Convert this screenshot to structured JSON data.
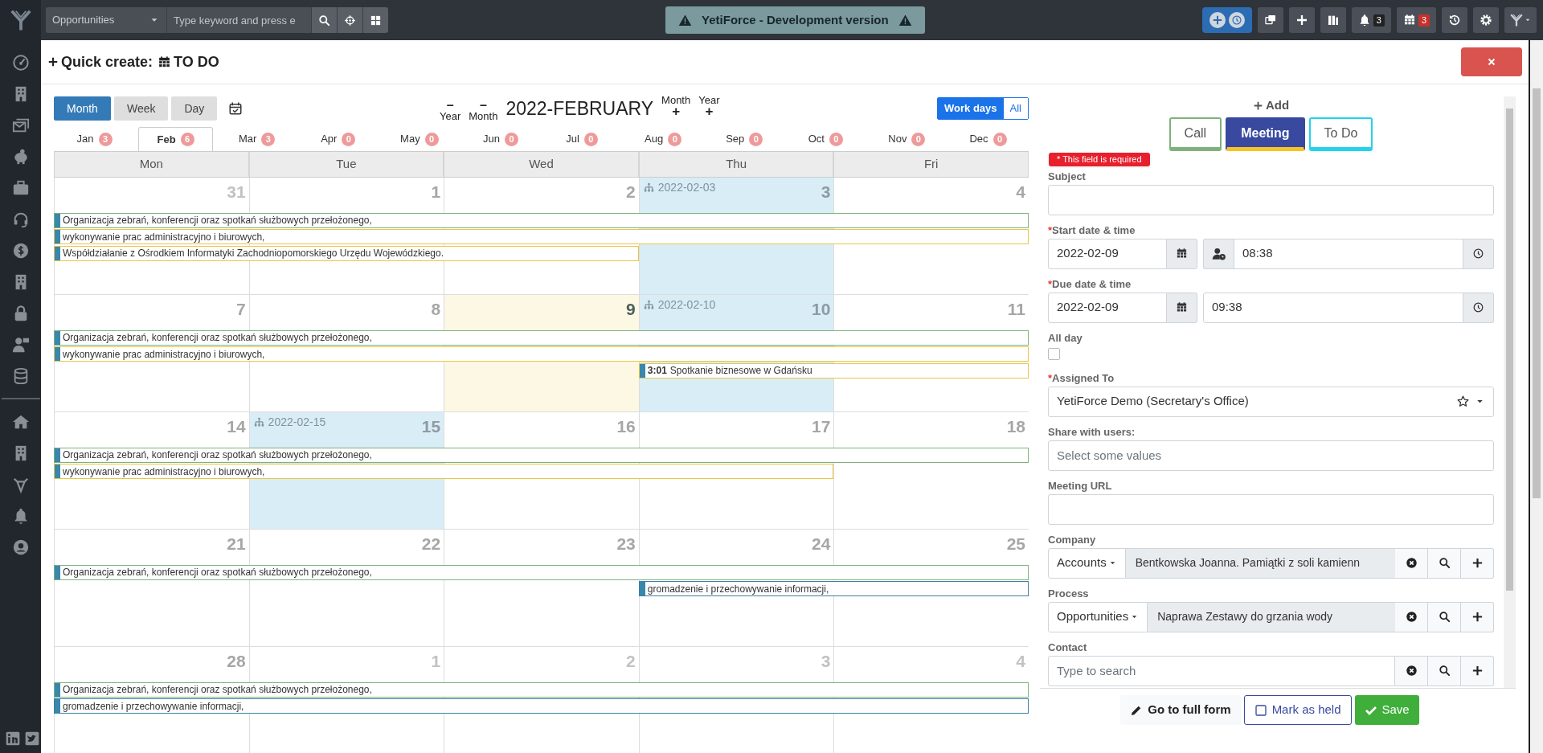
{
  "topbar": {
    "module": "Opportunities",
    "search_placeholder": "Type keyword and press e",
    "banner": "YetiForce - Development version",
    "bell_count": "3",
    "calendar_count": "3"
  },
  "modal": {
    "title_prefix": "Quick create:",
    "title": "TO DO"
  },
  "calendar": {
    "views": [
      {
        "label": "Month",
        "selected": true
      },
      {
        "label": "Week",
        "selected": false
      },
      {
        "label": "Day",
        "selected": false
      }
    ],
    "prev": [
      {
        "symbol": "–",
        "label": "Year"
      },
      {
        "symbol": "–",
        "label": "Month"
      }
    ],
    "title": "2022-FEBRUARY",
    "next": [
      {
        "label": "Month",
        "symbol": "+"
      },
      {
        "label": "Year",
        "symbol": "+"
      }
    ],
    "day_filter": [
      {
        "label": "Work days",
        "selected": true
      },
      {
        "label": "All",
        "selected": false
      }
    ],
    "months": [
      {
        "label": "Jan",
        "count": "3",
        "selected": false
      },
      {
        "label": "Feb",
        "count": "6",
        "selected": true
      },
      {
        "label": "Mar",
        "count": "3",
        "selected": false
      },
      {
        "label": "Apr",
        "count": "0",
        "selected": false
      },
      {
        "label": "May",
        "count": "0",
        "selected": false
      },
      {
        "label": "Jun",
        "count": "0",
        "selected": false
      },
      {
        "label": "Jul",
        "count": "0",
        "selected": false
      },
      {
        "label": "Aug",
        "count": "0",
        "selected": false
      },
      {
        "label": "Sep",
        "count": "0",
        "selected": false
      },
      {
        "label": "Oct",
        "count": "0",
        "selected": false
      },
      {
        "label": "Nov",
        "count": "0",
        "selected": false
      },
      {
        "label": "Dec",
        "count": "0",
        "selected": false
      }
    ],
    "weekdays": [
      "Mon",
      "Tue",
      "Wed",
      "Thu",
      "Fri"
    ],
    "weeks": [
      {
        "days": [
          {
            "number": "31",
            "other_month": true,
            "today": false
          },
          {
            "number": "1",
            "other_month": false,
            "today": false
          },
          {
            "number": "2",
            "other_month": false,
            "today": false
          },
          {
            "number": "3",
            "other_month": false,
            "today": false,
            "holiday": "2022-02-03"
          },
          {
            "number": "4",
            "other_month": false,
            "today": false
          }
        ],
        "events": [
          {
            "text": "Organizacja zebrań, konferencji oraz spotkań służbowych przełożonego,",
            "color": "#7fb17f"
          },
          {
            "text": "wykonywanie prac administracyjno i biurowych,",
            "color": "#e8c547"
          },
          {
            "text": "Współdziałanie z Ośrodkiem Informatyki Zachodniopomorskiego Urzędu Wojewódzkiego.",
            "color": "#e8c547"
          }
        ]
      },
      {
        "days": [
          {
            "number": "7",
            "other_month": false,
            "today": false
          },
          {
            "number": "8",
            "other_month": false,
            "today": false
          },
          {
            "number": "9",
            "other_month": false,
            "today": true
          },
          {
            "number": "10",
            "other_month": false,
            "today": false,
            "holiday": "2022-02-10"
          },
          {
            "number": "11",
            "other_month": false,
            "today": false
          }
        ],
        "events": [
          {
            "text": "Organizacja zebrań, konferencji oraz spotkań służbowych przełożonego,",
            "color": "#7fb17f"
          },
          {
            "text": "wykonywanie prac administracyjno i biurowych,",
            "color": "#e8c547"
          },
          {
            "time": "3:01",
            "text": "Spotkanie biznesowe w Gdańsku",
            "color": "#e8c547"
          }
        ]
      },
      {
        "days": [
          {
            "number": "14",
            "other_month": false,
            "today": false
          },
          {
            "number": "15",
            "other_month": false,
            "today": false,
            "holiday": "2022-02-15"
          },
          {
            "number": "16",
            "other_month": false,
            "today": false
          },
          {
            "number": "17",
            "other_month": false,
            "today": false
          },
          {
            "number": "18",
            "other_month": false,
            "today": false
          }
        ],
        "events": [
          {
            "text": "Organizacja zebrań, konferencji oraz spotkań służbowych przełożonego,",
            "color": "#7fb17f"
          },
          {
            "text": "wykonywanie prac administracyjno i biurowych,",
            "color": "#e8c547"
          }
        ]
      },
      {
        "days": [
          {
            "number": "21",
            "other_month": false,
            "today": false
          },
          {
            "number": "22",
            "other_month": false,
            "today": false
          },
          {
            "number": "23",
            "other_month": false,
            "today": false
          },
          {
            "number": "24",
            "other_month": false,
            "today": false
          },
          {
            "number": "25",
            "other_month": false,
            "today": false
          }
        ],
        "events": [
          {
            "text": "Organizacja zebrań, konferencji oraz spotkań służbowych przełożonego,",
            "color": "#7fb17f"
          },
          {
            "text": "gromadzenie i przechowywanie informacji,",
            "color": "#3b7ea1"
          }
        ]
      },
      {
        "days": [
          {
            "number": "28",
            "other_month": false,
            "today": false
          },
          {
            "number": "1",
            "other_month": true,
            "today": false
          },
          {
            "number": "2",
            "other_month": true,
            "today": false
          },
          {
            "number": "3",
            "other_month": true,
            "today": false
          },
          {
            "number": "4",
            "other_month": true,
            "today": false
          }
        ],
        "events": [
          {
            "text": "Organizacja zebrań, konferencji oraz spotkań służbowych przełożonego,",
            "color": "#7fb17f"
          },
          {
            "text": "gromadzenie i przechowywanie informacji,",
            "color": "#3b7ea1"
          }
        ]
      }
    ]
  },
  "form": {
    "add_label": "Add",
    "types": [
      {
        "label": "Call",
        "selected": false,
        "color": "#7fb17f"
      },
      {
        "label": "Meeting",
        "selected": true,
        "color": "#f7c325"
      },
      {
        "label": "To Do",
        "selected": false,
        "color": "#22d3ee"
      }
    ],
    "error_tooltip": "* This field is required",
    "fields": [
      {
        "kind": "text",
        "label": "Subject"
      },
      {
        "kind": "datetime",
        "label": "Start date & time",
        "required_mark": "*",
        "date": "2022-02-09",
        "time": "08:38",
        "user_time": true
      },
      {
        "kind": "datetime",
        "label": "Due date & time",
        "required_mark": "*",
        "date": "2022-02-09",
        "time": "09:38"
      },
      {
        "kind": "checkbox",
        "label": "All day",
        "checked": false
      },
      {
        "kind": "select",
        "label": "Assigned To",
        "required_mark": "*",
        "value": "YetiForce Demo (Secretary's Office)"
      },
      {
        "kind": "multiselect",
        "label": "Share with users:",
        "placeholder": "Select some values"
      },
      {
        "kind": "text",
        "label": "Meeting URL"
      },
      {
        "kind": "reference",
        "label": "Company",
        "module": "Accounts",
        "value": "Bentkowska Joanna. Pamiątki z soli kamienn"
      },
      {
        "kind": "reference",
        "label": "Process",
        "module": "Opportunities",
        "value": "Naprawa Zestawy do grzania wody"
      },
      {
        "kind": "reference",
        "label": "Contact",
        "placeholder": "Type to search"
      }
    ],
    "footer": [
      {
        "kind": "link",
        "label": "Go to full form"
      },
      {
        "kind": "outline",
        "label": "Mark as held"
      },
      {
        "kind": "primary",
        "label": "Save"
      }
    ]
  }
}
